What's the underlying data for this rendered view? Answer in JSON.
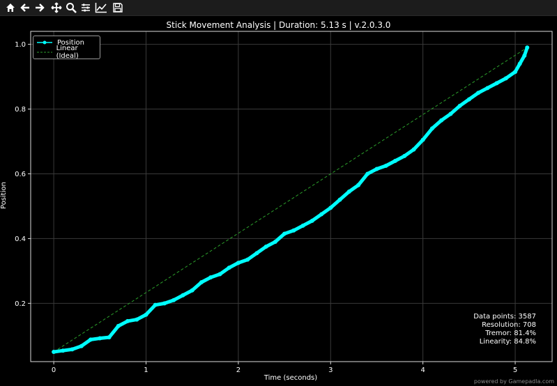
{
  "toolbar": {
    "buttons": [
      {
        "name": "home-icon"
      },
      {
        "name": "back-arrow-icon"
      },
      {
        "name": "forward-arrow-icon"
      },
      {
        "name": "pan-move-icon"
      },
      {
        "name": "zoom-magnifier-icon"
      },
      {
        "name": "configure-subplots-icon"
      },
      {
        "name": "edit-axis-icon"
      },
      {
        "name": "save-floppy-icon"
      }
    ]
  },
  "chart_data": {
    "type": "line",
    "title": "Stick Movement Analysis | Duration: 5.13 s | v.2.0.3.0",
    "xlabel": "Time (seconds)",
    "ylabel": "Position",
    "xlim": [
      -0.25,
      5.4
    ],
    "ylim": [
      0.02,
      1.04
    ],
    "xticks": [
      "0",
      "1",
      "2",
      "3",
      "4",
      "5"
    ],
    "yticks": [
      "0.2",
      "0.4",
      "0.6",
      "0.8",
      "1.0"
    ],
    "grid": true,
    "legend_position": "top-left",
    "series": [
      {
        "name": "Position",
        "color": "#00ffff",
        "style": "solid-with-markers",
        "x": [
          0,
          0.1,
          0.2,
          0.3,
          0.4,
          0.5,
          0.6,
          0.7,
          0.8,
          0.9,
          1.0,
          1.1,
          1.2,
          1.3,
          1.4,
          1.5,
          1.6,
          1.7,
          1.8,
          1.9,
          2.0,
          2.1,
          2.2,
          2.3,
          2.4,
          2.5,
          2.6,
          2.7,
          2.8,
          2.9,
          3.0,
          3.1,
          3.2,
          3.3,
          3.4,
          3.5,
          3.6,
          3.7,
          3.8,
          3.9,
          4.0,
          4.1,
          4.2,
          4.3,
          4.4,
          4.5,
          4.6,
          4.7,
          4.8,
          4.9,
          5.0,
          5.05,
          5.1,
          5.13
        ],
        "values": [
          0.05,
          0.054,
          0.058,
          0.068,
          0.088,
          0.092,
          0.095,
          0.13,
          0.145,
          0.15,
          0.165,
          0.195,
          0.2,
          0.21,
          0.225,
          0.24,
          0.265,
          0.28,
          0.29,
          0.31,
          0.325,
          0.335,
          0.355,
          0.375,
          0.39,
          0.415,
          0.425,
          0.44,
          0.455,
          0.475,
          0.495,
          0.52,
          0.545,
          0.565,
          0.6,
          0.615,
          0.625,
          0.64,
          0.655,
          0.675,
          0.705,
          0.74,
          0.765,
          0.785,
          0.81,
          0.83,
          0.85,
          0.865,
          0.88,
          0.895,
          0.915,
          0.94,
          0.965,
          0.99
        ]
      },
      {
        "name": "Linear (Ideal)",
        "color": "#2ca02c",
        "style": "dashed",
        "x": [
          0,
          5.13
        ],
        "values": [
          0.05,
          0.99
        ]
      }
    ]
  },
  "stats": {
    "data_points": "Data points: 3587",
    "resolution": "Resolution: 708",
    "tremor": "Tremor: 81.4%",
    "linearity": "Linearity: 84.8%"
  },
  "footer": "powered by Gamepadla.com"
}
